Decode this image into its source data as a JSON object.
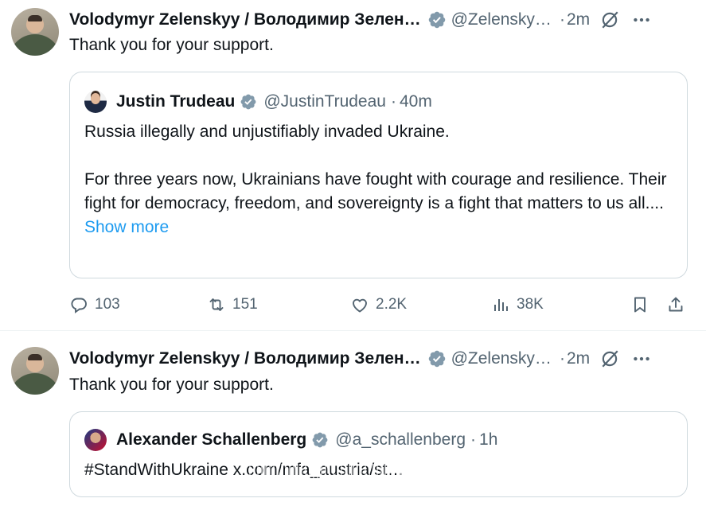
{
  "tweets": [
    {
      "author": {
        "name": "Volodymyr Zelenskyy / Володимир Зелен…",
        "handle": "@Zelensky…",
        "time": "2m"
      },
      "text": "Thank you for your support.",
      "quote": {
        "name": "Justin Trudeau",
        "handle": "@JustinTrudeau",
        "time": "40m",
        "paragraph1": "Russia illegally and unjustifiably invaded Ukraine.",
        "paragraph2": "For three years now, Ukrainians have fought with courage and resilience. Their fight for democracy, freedom, and sovereignty is a fight that matters to us all....",
        "show_more": "Show more"
      },
      "stats": {
        "replies": "103",
        "reposts": "151",
        "likes": "2.2K",
        "views": "38K"
      }
    },
    {
      "author": {
        "name": "Volodymyr Zelenskyy / Володимир Зелен…",
        "handle": "@Zelensky…",
        "time": "2m"
      },
      "text": "Thank you for your support.",
      "quote": {
        "name": "Alexander Schallenberg",
        "handle": "@a_schallenberg",
        "time": "1h",
        "paragraph1": "#StandWithUkraine x.com/mfa_austria/st…"
      }
    }
  ],
  "separator": "·",
  "colors": {
    "text": "#0f1419",
    "secondary": "#536471",
    "link": "#1d9bf0",
    "verified": "#829aab",
    "border": "#cfd9de"
  },
  "icons": [
    "verified-badge-icon",
    "grok-icon",
    "more-icon",
    "reply-icon",
    "repost-icon",
    "like-icon",
    "views-icon",
    "bookmark-icon",
    "share-icon"
  ]
}
